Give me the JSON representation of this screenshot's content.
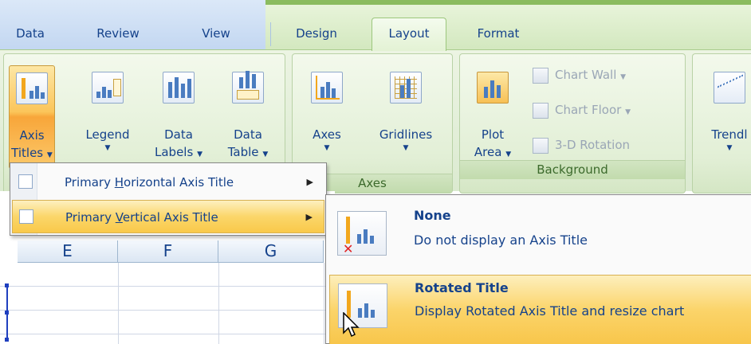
{
  "tabs": [
    {
      "label": "Data"
    },
    {
      "label": "Review"
    },
    {
      "label": "View"
    },
    {
      "label": "Design"
    },
    {
      "label": "Layout",
      "active": true
    },
    {
      "label": "Format"
    }
  ],
  "ribbon": {
    "labels_group": {
      "buttons": [
        {
          "label": "Axis",
          "label2": "Titles",
          "arrow": "▼",
          "icon": "axis-titles-icon"
        },
        {
          "label": "Legend",
          "label2": "",
          "arrow": "▼",
          "icon": "legend-icon"
        },
        {
          "label": "Data",
          "label2": "Labels",
          "arrow": "▼",
          "icon": "data-labels-icon"
        },
        {
          "label": "Data",
          "label2": "Table",
          "arrow": "▼",
          "icon": "data-table-icon"
        }
      ]
    },
    "axes_group": {
      "label": "Axes",
      "buttons": [
        {
          "label": "Axes",
          "arrow": "▼",
          "icon": "axes-icon"
        },
        {
          "label": "Gridlines",
          "arrow": "▼",
          "icon": "gridlines-icon"
        }
      ]
    },
    "background_group": {
      "label": "Background",
      "plot_area": {
        "label": "Plot",
        "label2": "Area",
        "arrow": "▼",
        "icon": "plot-area-icon"
      },
      "small_buttons": [
        {
          "label": "Chart Wall",
          "arrow": "▼",
          "icon": "chart-wall-icon"
        },
        {
          "label": "Chart Floor",
          "arrow": "▼",
          "icon": "chart-floor-icon"
        },
        {
          "label": "3-D Rotation",
          "arrow": "",
          "icon": "3d-rotation-icon"
        }
      ]
    },
    "analysis_group": {
      "trendline": {
        "label": "Trendl",
        "arrow": "▼",
        "icon": "trendline-icon"
      }
    }
  },
  "sheet": {
    "columns": [
      "E",
      "F",
      "G"
    ]
  },
  "axis_menu": {
    "items": [
      {
        "label_pre": "Primary ",
        "label_key": "H",
        "label_post": "orizontal Axis Title",
        "arrow": "▶",
        "icon": "horizontal-axis-title-icon"
      },
      {
        "label_pre": "Primary ",
        "label_key": "V",
        "label_post": "ertical Axis Title",
        "arrow": "▶",
        "icon": "vertical-axis-title-icon"
      }
    ]
  },
  "sub_menu": {
    "items": [
      {
        "title": "None",
        "desc": "Do not display an Axis Title",
        "icon": "no-axis-title-icon"
      },
      {
        "title": "Rotated Title",
        "desc": "Display Rotated Axis Title and resize chart",
        "icon": "rotated-title-icon"
      }
    ]
  },
  "colors": {
    "accent_orange": "#f9c94a",
    "chart_tools_green": "#8bbc5f",
    "text_blue": "#15428b"
  }
}
